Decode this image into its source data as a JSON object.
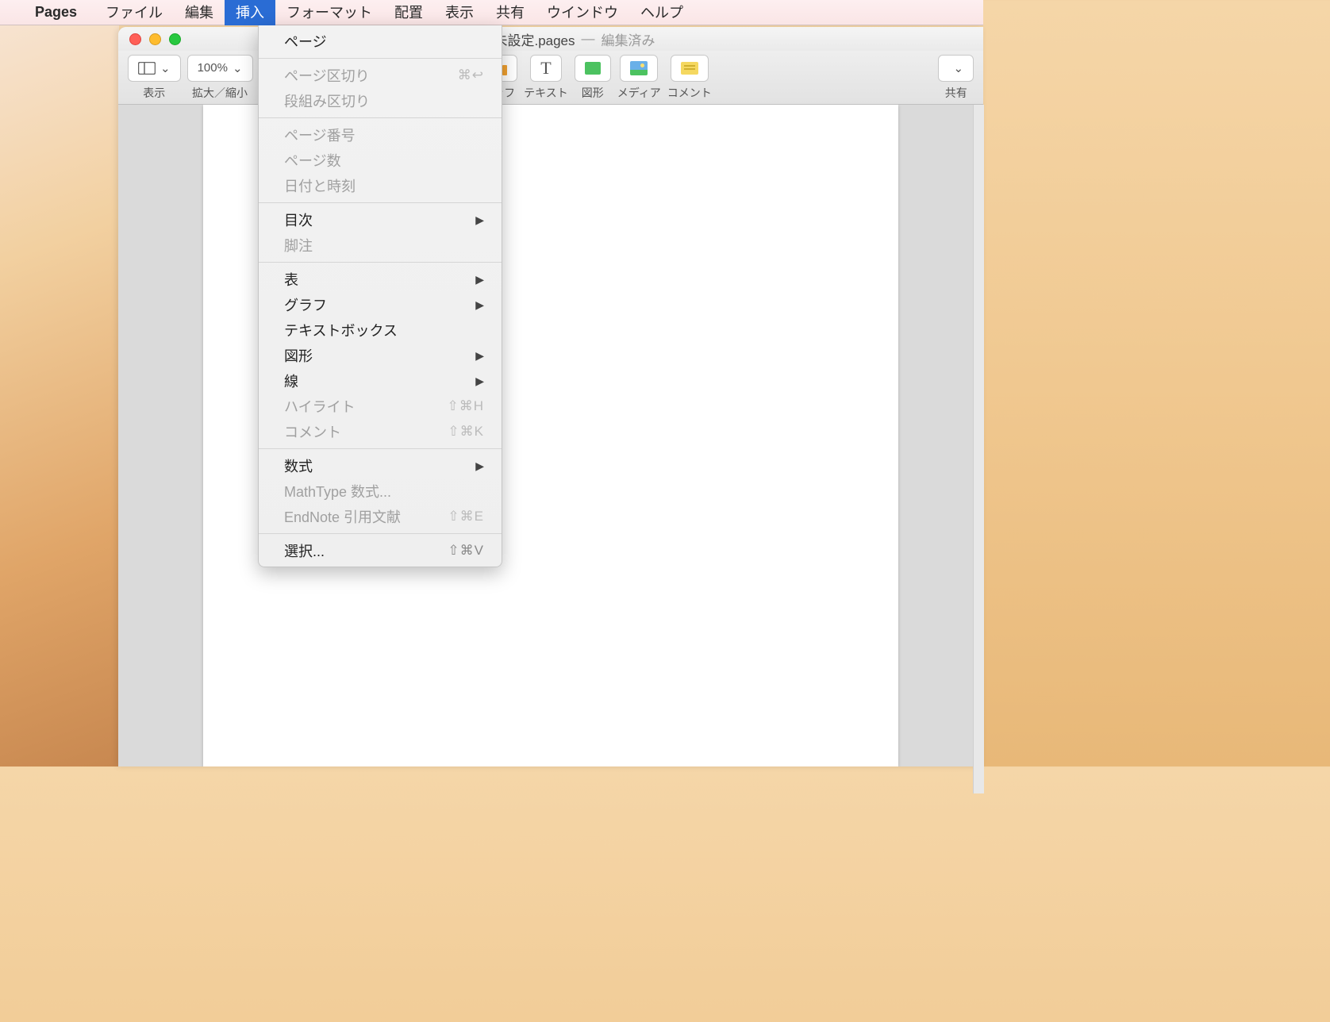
{
  "menubar": {
    "appname": "Pages",
    "items": [
      "ファイル",
      "編集",
      "挿入",
      "フォーマット",
      "配置",
      "表示",
      "共有",
      "ウインドウ",
      "ヘルプ"
    ],
    "active_index": 2
  },
  "window": {
    "title_filename": "名称未設定.pages",
    "title_sep": "—",
    "title_status": "編集済み"
  },
  "toolbar": {
    "view_label": "表示",
    "zoom_value": "100%",
    "zoom_label": "拡大／縮小",
    "chart_label": "グラフ",
    "text_label": "テキスト",
    "shape_label": "図形",
    "media_label": "メディア",
    "comment_label": "コメント",
    "share_label": "共有"
  },
  "menu": {
    "groups": [
      [
        {
          "label": "ページ",
          "enabled": true
        }
      ],
      [
        {
          "label": "ページ区切り",
          "enabled": false,
          "shortcut": "⌘↩"
        },
        {
          "label": "段組み区切り",
          "enabled": false
        }
      ],
      [
        {
          "label": "ページ番号",
          "enabled": false
        },
        {
          "label": "ページ数",
          "enabled": false
        },
        {
          "label": "日付と時刻",
          "enabled": false
        }
      ],
      [
        {
          "label": "目次",
          "enabled": true,
          "submenu": true
        },
        {
          "label": "脚注",
          "enabled": false
        }
      ],
      [
        {
          "label": "表",
          "enabled": true,
          "submenu": true
        },
        {
          "label": "グラフ",
          "enabled": true,
          "submenu": true
        },
        {
          "label": "テキストボックス",
          "enabled": true
        },
        {
          "label": "図形",
          "enabled": true,
          "submenu": true
        },
        {
          "label": "線",
          "enabled": true,
          "submenu": true
        },
        {
          "label": "ハイライト",
          "enabled": false,
          "shortcut": "⇧⌘H"
        },
        {
          "label": "コメント",
          "enabled": false,
          "shortcut": "⇧⌘K"
        }
      ],
      [
        {
          "label": "数式",
          "enabled": true,
          "submenu": true
        },
        {
          "label": "MathType 数式...",
          "enabled": false
        },
        {
          "label": "EndNote 引用文献",
          "enabled": false,
          "shortcut": "⇧⌘E"
        }
      ],
      [
        {
          "label": "選択...",
          "enabled": true,
          "shortcut": "⇧⌘V"
        }
      ]
    ]
  }
}
